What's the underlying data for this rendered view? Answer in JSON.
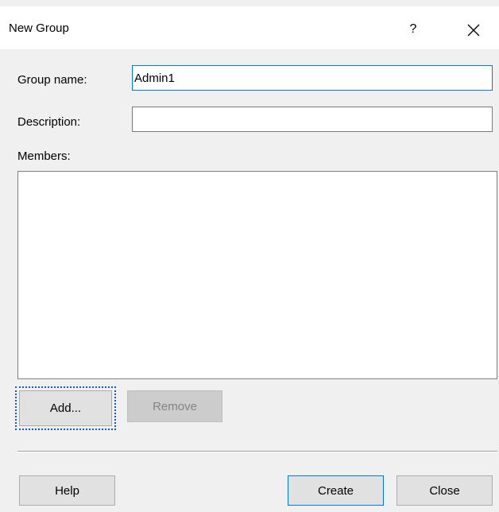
{
  "window": {
    "title": "New Group",
    "help_glyph": "?",
    "help_icon": "question-icon",
    "close_icon": "close-x-icon"
  },
  "form": {
    "group_name_label": "Group name:",
    "group_name_value": "Admin1",
    "description_label": "Description:",
    "description_value": "",
    "members_label": "Members:"
  },
  "members": {
    "buttons": {
      "add": "Add...",
      "remove": "Remove"
    },
    "items": []
  },
  "footer": {
    "help": "Help",
    "create": "Create",
    "close": "Close"
  },
  "colors": {
    "focus_accent": "#0078d7",
    "dialog_bg": "#f0f0f0",
    "button_bg": "#e1e1e1"
  }
}
